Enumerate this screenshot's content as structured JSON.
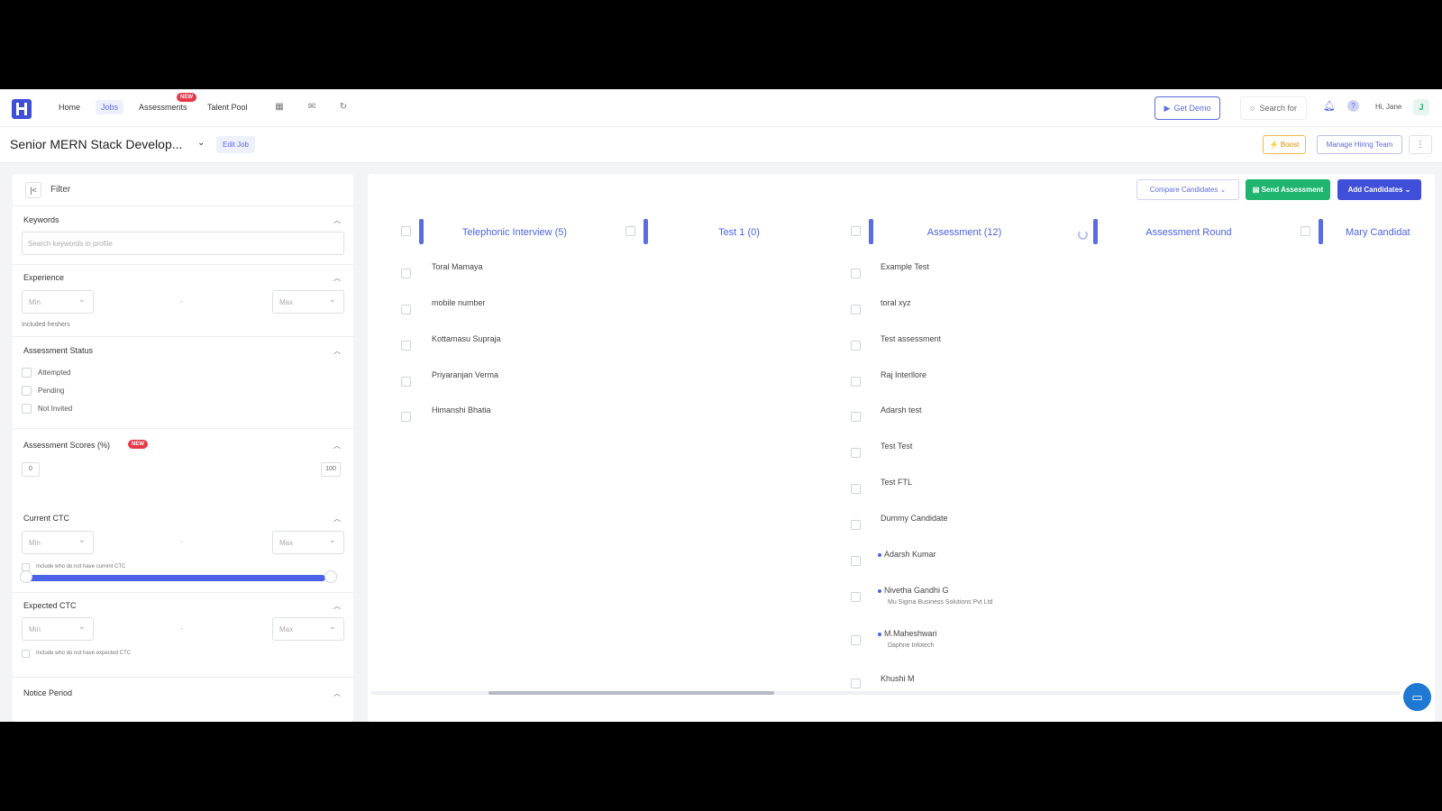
{
  "nav": {
    "links": [
      "Home",
      "Jobs",
      "Assessments",
      "Talent Pool"
    ],
    "new_badge": "NEW",
    "get_demo": "Get Demo",
    "search": "Search for",
    "greeting": "Hi, Jane",
    "avatar": "J"
  },
  "job": {
    "title": "Senior MERN Stack Develop...",
    "edit": "Edit Job",
    "boost": "⚡ Boost",
    "manage_team": "Manage Hiring Team",
    "more": "⋮"
  },
  "filter": {
    "title": "Filter",
    "keywords_label": "Keywords",
    "keywords_placeholder": "Search keywords in profile",
    "experience_label": "Experience",
    "min": "Min",
    "max": "Max",
    "freshers_note": "Included freshers",
    "assessment_status_label": "Assessment Status",
    "statuses": [
      "Attempted",
      "Pending",
      "Not Invited"
    ],
    "scores_label": "Assessment Scores (%)",
    "scores_new": "NEW",
    "score_min": "0",
    "score_max": "100",
    "current_ctc_label": "Current CTC",
    "current_ctc_note": "Include who do not have current CTC",
    "expected_ctc_label": "Expected CTC",
    "expected_ctc_note": "Include who do not have expected CTC",
    "notice_period_label": "Notice Period"
  },
  "actions": {
    "compare": "Compare Candidates ⌄",
    "send": "▤ Send Assessment",
    "add": "Add Candidates ⌄"
  },
  "columns": [
    {
      "name": "Telephonic Interview (5)",
      "candidates": [
        "Toral Mamaya",
        "mobile number",
        "Kottamasu Supraja",
        "Priyaranjan Verma",
        "Himanshi Bhatia"
      ]
    },
    {
      "name": "Test 1 (0)",
      "candidates": []
    },
    {
      "name": "Assessment (12)",
      "candidates": [
        "Example Test",
        "toral xyz",
        "Test assessment",
        "Raj Interllore",
        "Adarsh test",
        "Test Test",
        "Test FTL",
        "Dummy Candidate",
        "Adarsh Kumar",
        "Nivetha Gandhi G",
        "M.Maheshwari",
        "Khushi M"
      ],
      "companies": {
        "Nivetha Gandhi G": "Mu Sigma Business Solutions Pvt Ltd",
        "M.Maheshwari": "Daphne Infotech"
      }
    },
    {
      "name": "Assessment Round",
      "candidates": []
    },
    {
      "name": "Mary Candidat",
      "candidates": []
    }
  ],
  "colors": {
    "brand": "#3f4fd8",
    "accent": "#4b63e6",
    "success": "#1fb56e",
    "badge": "#e5394a"
  }
}
